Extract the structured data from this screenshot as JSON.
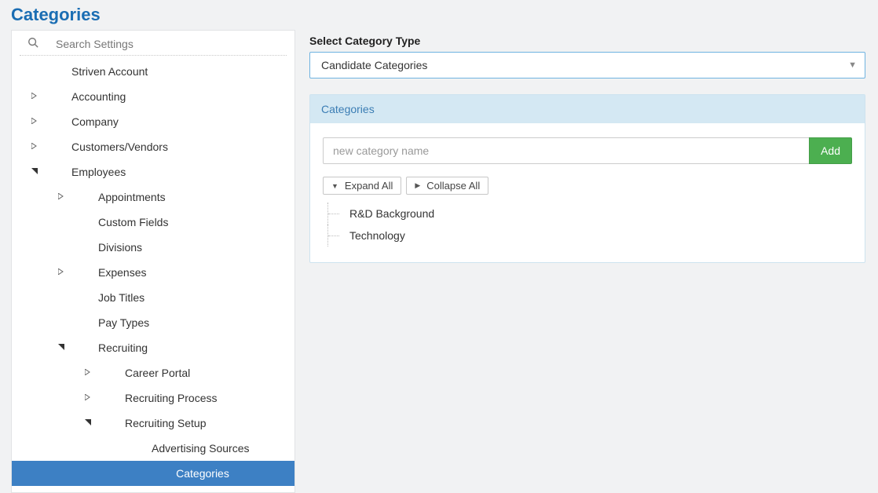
{
  "page_title": "Categories",
  "sidebar": {
    "search_placeholder": "Search Settings",
    "items": [
      {
        "label": "Striven Account",
        "arrow": "none",
        "level": 0,
        "selected": false,
        "labelPad": true
      },
      {
        "label": "Accounting",
        "arrow": "right",
        "level": 0,
        "selected": false
      },
      {
        "label": "Company",
        "arrow": "right",
        "level": 0,
        "selected": false
      },
      {
        "label": "Customers/Vendors",
        "arrow": "right",
        "level": 0,
        "selected": false
      },
      {
        "label": "Employees",
        "arrow": "down",
        "level": 0,
        "selected": false
      },
      {
        "label": "Appointments",
        "arrow": "right",
        "level": 1,
        "selected": false
      },
      {
        "label": "Custom Fields",
        "arrow": "none",
        "level": 1,
        "selected": false,
        "labelPad": true
      },
      {
        "label": "Divisions",
        "arrow": "none",
        "level": 1,
        "selected": false,
        "labelPad": true
      },
      {
        "label": "Expenses",
        "arrow": "right",
        "level": 1,
        "selected": false
      },
      {
        "label": "Job Titles",
        "arrow": "none",
        "level": 1,
        "selected": false,
        "labelPad": true
      },
      {
        "label": "Pay Types",
        "arrow": "none",
        "level": 1,
        "selected": false,
        "labelPad": true
      },
      {
        "label": "Recruiting",
        "arrow": "down",
        "level": 1,
        "selected": false
      },
      {
        "label": "Career Portal",
        "arrow": "right",
        "level": 2,
        "selected": false
      },
      {
        "label": "Recruiting Process",
        "arrow": "right",
        "level": 2,
        "selected": false
      },
      {
        "label": "Recruiting Setup",
        "arrow": "down",
        "level": 2,
        "selected": false
      },
      {
        "label": "Advertising Sources",
        "arrow": "none",
        "level": 3,
        "selected": false
      },
      {
        "label": "Categories",
        "arrow": "none",
        "level": 3,
        "selected": true
      }
    ]
  },
  "main": {
    "select_label": "Select Category Type",
    "select_value": "Candidate Categories",
    "panel_title": "Categories",
    "new_placeholder": "new category name",
    "add_label": "Add",
    "expand_label": "Expand All",
    "collapse_label": "Collapse All",
    "categories": [
      "R&D Background",
      "Technology"
    ]
  }
}
